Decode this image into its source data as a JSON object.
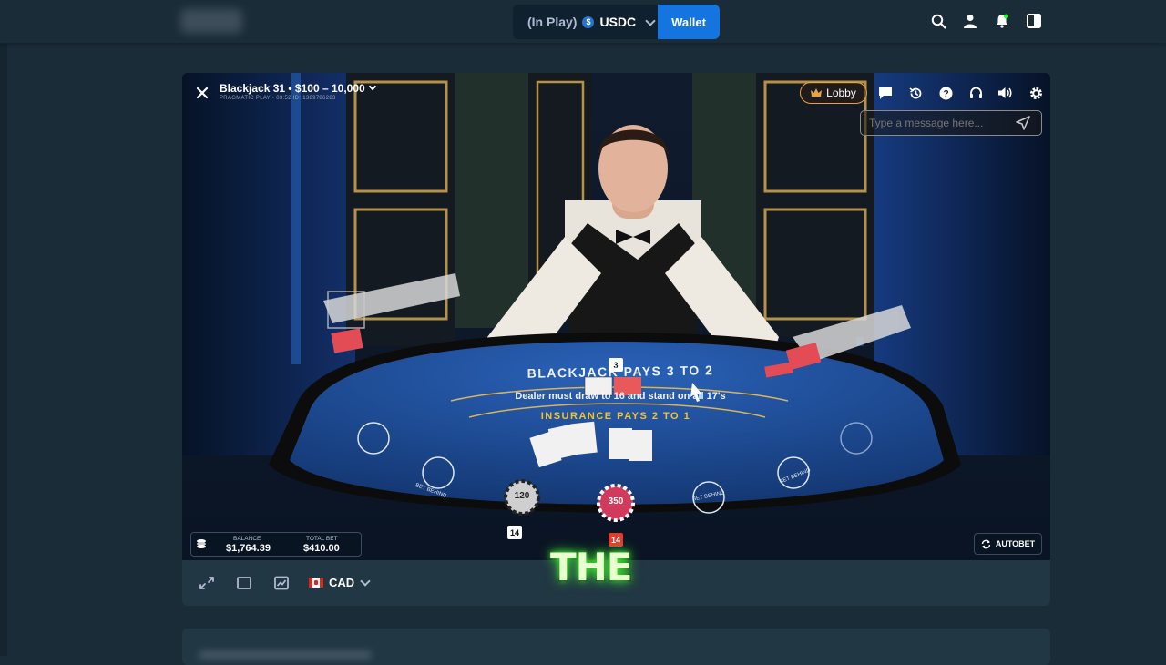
{
  "header": {
    "balance_status": "(In Play)",
    "currency": "USDC",
    "coin_symbol": "$",
    "wallet_label": "Wallet",
    "icons": [
      "search-icon",
      "user-icon",
      "notification-icon",
      "sidebar-toggle-icon"
    ]
  },
  "game": {
    "title": "Blackjack 31 • $100 – 10,000",
    "subtitle": "PRAGMATIC PLAY • 03:52 ID: 1389786283",
    "lobby_label": "Lobby",
    "tools": [
      "chat-icon",
      "history-icon",
      "help-icon",
      "support-icon",
      "volume-icon",
      "settings-icon"
    ],
    "chat_placeholder": "Type a message here...",
    "balance_label": "BALANCE",
    "balance_value": "$1,764.39",
    "total_bet_label": "TOTAL BET",
    "total_bet_value": "$410.00",
    "autobet_label": "AUTOBET",
    "dealer_count": "3",
    "seat_count_1": "14",
    "seat_count_2": "14",
    "chip_1": "120",
    "chip_2": "350",
    "table_line_1": "BLACKJACK PAYS 3 TO 2",
    "table_line_2": "Dealer must draw to 16 and stand on all 17's",
    "table_line_3": "INSURANCE PAYS 2 TO 1",
    "bet_behind": "BET BEHIND"
  },
  "bottom_bar": {
    "currency_label": "CAD",
    "icons": [
      "fullscreen-icon",
      "theatre-mode-icon",
      "stats-icon"
    ]
  },
  "caption": "THE",
  "colors": {
    "background": "#1a2c38",
    "panel": "#213743",
    "wallet_blue": "#1475e1",
    "lobby_gold": "#e8a33d",
    "felt_blue": "#1d4fa0",
    "caption_glow": "#4cff3a"
  }
}
